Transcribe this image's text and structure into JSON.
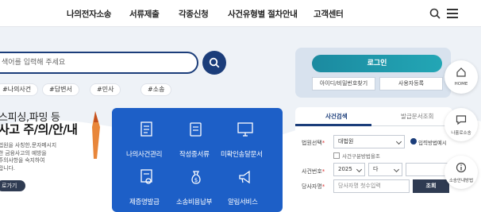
{
  "nav": {
    "items": [
      "나의전자소송",
      "서류제출",
      "각종신청",
      "사건유형별 절차안내",
      "고객센터"
    ]
  },
  "search": {
    "placeholder": "색어를 입력해 주세요",
    "tags": [
      "#나의사건",
      "#답변서",
      "#민사",
      "#소송"
    ]
  },
  "promo": {
    "line1": "스피싱,파밍 등",
    "line2": "사고 주/의/안/내",
    "desc": [
      "법원을 사칭한,문자메시지",
      "한 금융사고의 예방을",
      "주의사항을 숙지하여",
      "랍니다."
    ],
    "button": "로가기"
  },
  "services": {
    "items": [
      {
        "label": "나의사건관리",
        "icon": "folder-document-icon"
      },
      {
        "label": "작성중서류",
        "icon": "document-edit-icon"
      },
      {
        "label": "미확인송달문서",
        "icon": "monitor-document-icon"
      },
      {
        "label": "제증명발급",
        "icon": "certificate-icon"
      },
      {
        "label": "소송비용납부",
        "icon": "money-bag-icon"
      },
      {
        "label": "알림서비스",
        "icon": "megaphone-icon"
      }
    ]
  },
  "login": {
    "button": "로그인",
    "find_id": "아이디/비밀번호찾기",
    "register": "사용자등록"
  },
  "case_search": {
    "tab_active": "사건검색",
    "tab_inactive": "발급문서조회",
    "court_label": "법원선택",
    "court_value": "대법원",
    "court_option": "입력방법예시",
    "court_check": "사건구분방법을조",
    "case_no_label": "사건번호",
    "year_value": "2025",
    "type_value": "다",
    "party_label": "당사자명",
    "party_placeholder": "당사자명 첫수입력",
    "query_button": "조회"
  },
  "quick": {
    "items": [
      {
        "label": "HOME",
        "icon": "home-icon"
      },
      {
        "label": "나홀로소송",
        "icon": "chat-icon"
      },
      {
        "label": "소송안내방법",
        "icon": "info-icon"
      }
    ]
  },
  "colors": {
    "navy": "#1b3d7a",
    "service_blue": "#1d5fc7",
    "teal": "#1b8aa0",
    "dark": "#2f3b52"
  }
}
